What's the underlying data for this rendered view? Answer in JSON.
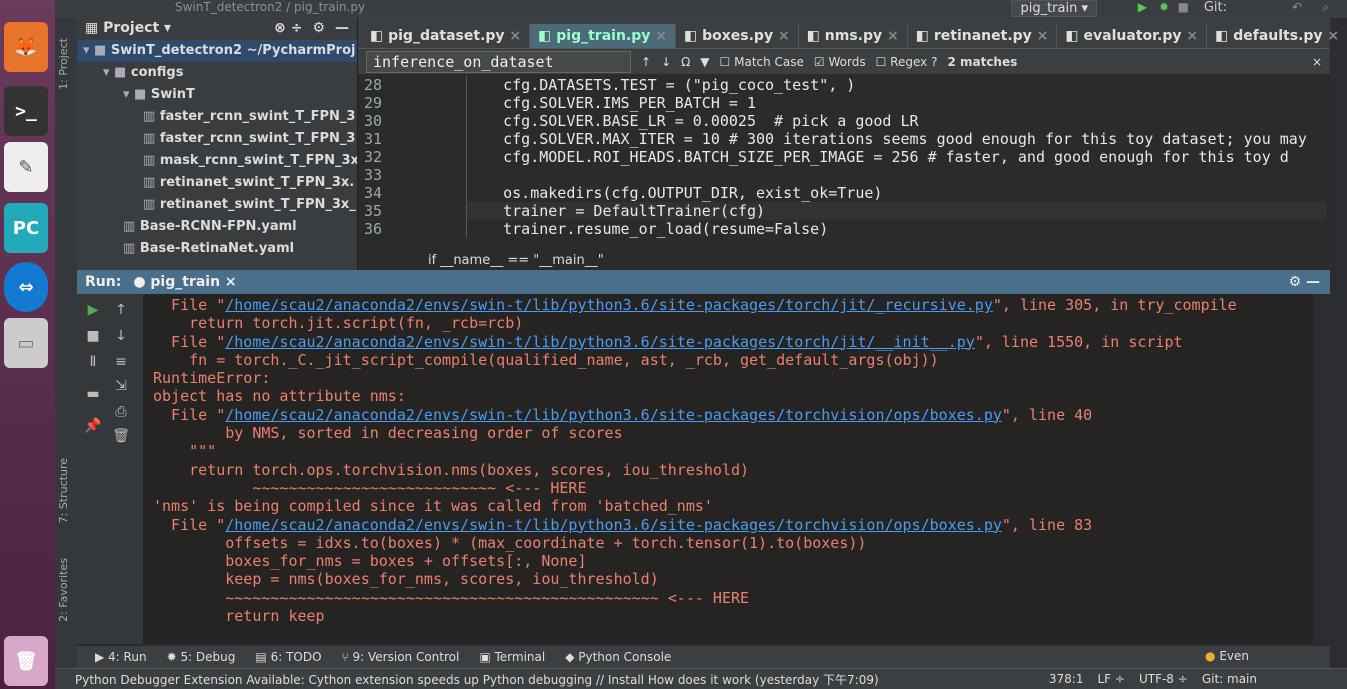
{
  "titlebar": {
    "path": "SwinT_detectron2 / pig_train.py",
    "run_config": "pig_train",
    "git_label": "Git:"
  },
  "launcher": {
    "apps": [
      "firefox-icon",
      "terminal-icon",
      "text-editor-icon",
      "pycharm-icon",
      "teamviewer-icon",
      "files-icon",
      "trash-icon"
    ],
    "pycharm_label": "PC"
  },
  "toolstrip": {
    "project": "1: Project",
    "structure": "7: Structure",
    "favorites": "2: Favorites"
  },
  "project": {
    "title": "Project",
    "items": [
      {
        "label": "SwinT_detectron2  ~/PycharmProj",
        "indent": 0,
        "kind": "folder",
        "open": true,
        "selected": true
      },
      {
        "label": "configs",
        "indent": 1,
        "kind": "folder",
        "open": true
      },
      {
        "label": "SwinT",
        "indent": 2,
        "kind": "folder",
        "open": true
      },
      {
        "label": "faster_rcnn_swint_T_FPN_3",
        "indent": 3,
        "kind": "file"
      },
      {
        "label": "faster_rcnn_swint_T_FPN_3",
        "indent": 3,
        "kind": "file"
      },
      {
        "label": "mask_rcnn_swint_T_FPN_3x",
        "indent": 3,
        "kind": "file"
      },
      {
        "label": "retinanet_swint_T_FPN_3x.",
        "indent": 3,
        "kind": "file"
      },
      {
        "label": "retinanet_swint_T_FPN_3x_",
        "indent": 3,
        "kind": "file"
      },
      {
        "label": "Base-RCNN-FPN.yaml",
        "indent": 2,
        "kind": "file"
      },
      {
        "label": "Base-RetinaNet.yaml",
        "indent": 2,
        "kind": "file"
      }
    ]
  },
  "editor": {
    "tabs": [
      {
        "label": "pig_dataset.py",
        "active": false
      },
      {
        "label": "pig_train.py",
        "active": true
      },
      {
        "label": "boxes.py",
        "active": false
      },
      {
        "label": "nms.py",
        "active": false
      },
      {
        "label": "retinanet.py",
        "active": false
      },
      {
        "label": "evaluator.py",
        "active": false
      },
      {
        "label": "defaults.py",
        "active": false
      }
    ],
    "find": {
      "query": "inference_on_dataset",
      "match_case": "Match Case",
      "match_case_checked": false,
      "words": "Words",
      "words_checked": true,
      "regex": "Regex",
      "regex_checked": false,
      "help": "?",
      "matches": "2 matches"
    },
    "line_numbers": [
      "28",
      "29",
      "30",
      "31",
      "32",
      "33",
      "34",
      "35",
      "36"
    ],
    "code_lines": [
      "    cfg.DATASETS.TEST = (\"pig_coco_test\", )",
      "    cfg.SOLVER.IMS_PER_BATCH = 1",
      "    cfg.SOLVER.BASE_LR = 0.00025  # pick a good LR",
      "    cfg.SOLVER.MAX_ITER = 10 # 300 iterations seems good enough for this toy dataset; you may",
      "    cfg.MODEL.ROI_HEADS.BATCH_SIZE_PER_IMAGE = 256 # faster, and good enough for this toy d",
      "",
      "    os.makedirs(cfg.OUTPUT_DIR, exist_ok=True)",
      "    trainer = DefaultTrainer(cfg)",
      "    trainer.resume_or_load(resume=False)"
    ],
    "breadcrumb": "if __name__ == \"__main__\""
  },
  "run": {
    "label": "Run:",
    "tab": "pig_train",
    "output": [
      {
        "pre": "  File \"",
        "link": "/home/scau2/anaconda2/envs/swin-t/lib/python3.6/site-packages/torch/jit/_recursive.py",
        "post": "\", line 305, in try_compile"
      },
      {
        "pre": "    return torch.jit.script(fn, _rcb=rcb)"
      },
      {
        "pre": "  File \"",
        "link": "/home/scau2/anaconda2/envs/swin-t/lib/python3.6/site-packages/torch/jit/__init__.py",
        "post": "\", line 1550, in script"
      },
      {
        "pre": "    fn = torch._C._jit_script_compile(qualified_name, ast, _rcb, get_default_args(obj))"
      },
      {
        "pre": "RuntimeError:"
      },
      {
        "pre": "object has no attribute nms:"
      },
      {
        "pre": "  File \"",
        "link": "/home/scau2/anaconda2/envs/swin-t/lib/python3.6/site-packages/torchvision/ops/boxes.py",
        "post": "\", line 40"
      },
      {
        "pre": "        by NMS, sorted in decreasing order of scores"
      },
      {
        "pre": "    \"\"\""
      },
      {
        "pre": "    return torch.ops.torchvision.nms(boxes, scores, iou_threshold)"
      },
      {
        "pre": "           ~~~~~~~~~~~~~~~~~~~~~~~~~~~ <--- HERE"
      },
      {
        "pre": "'nms' is being compiled since it was called from 'batched_nms'"
      },
      {
        "pre": "  File \"",
        "link": "/home/scau2/anaconda2/envs/swin-t/lib/python3.6/site-packages/torchvision/ops/boxes.py",
        "post": "\", line 83"
      },
      {
        "pre": "        offsets = idxs.to(boxes) * (max_coordinate + torch.tensor(1).to(boxes))"
      },
      {
        "pre": "        boxes_for_nms = boxes + offsets[:, None]"
      },
      {
        "pre": "        keep = nms(boxes_for_nms, scores, iou_threshold)"
      },
      {
        "pre": "        ~~~~~~~~~~~~~~~~~~~~~~~~~~~~~~~~~~~~~~~~~~~~~~~~ <--- HERE"
      },
      {
        "pre": "        return keep"
      }
    ]
  },
  "bottom_tabs": [
    "4: Run",
    "5: Debug",
    "6: TODO",
    "9: Version Control",
    "Terminal",
    "Python Console"
  ],
  "event_log": "Even",
  "status": {
    "message": "Python Debugger Extension Available: Cython extension speeds up Python debugging // Install How does it work (yesterday 下午7:09)",
    "position": "378:1",
    "line_sep": "LF ÷",
    "encoding": "UTF-8 ÷",
    "git": "Git: main"
  }
}
